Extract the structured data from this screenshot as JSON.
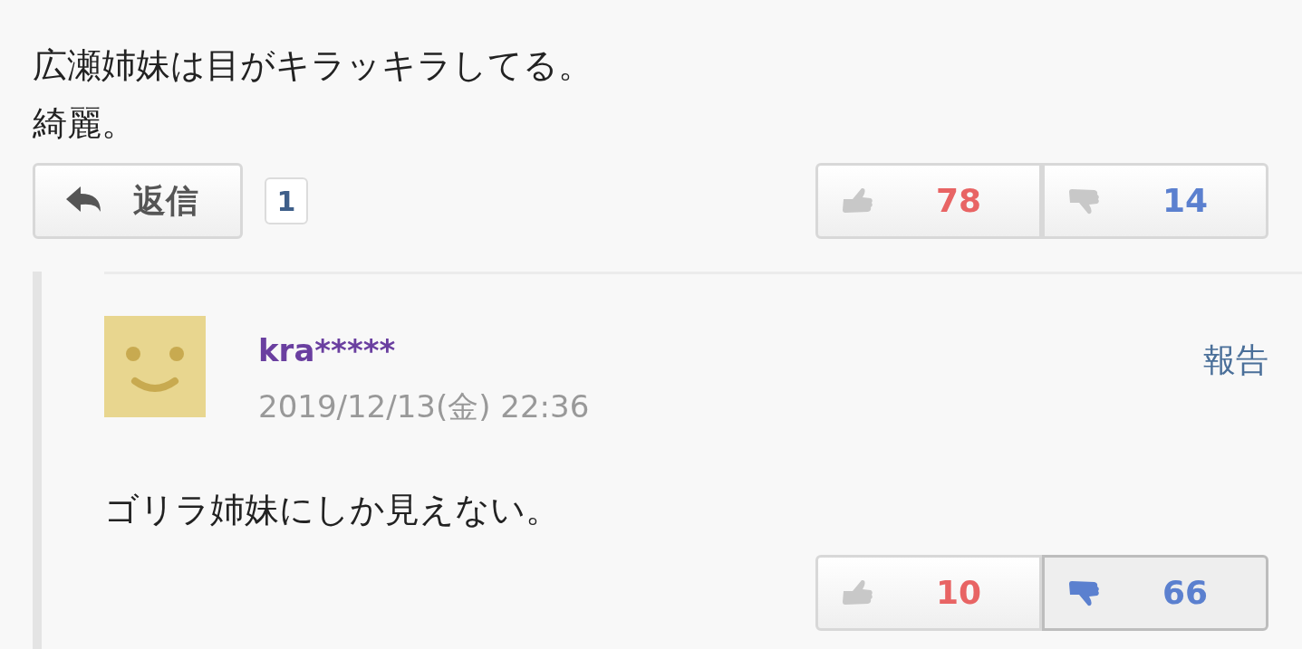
{
  "comment": {
    "text_lines": [
      "広瀬姉妹は目がキラッキラしてる。",
      "綺麗。"
    ],
    "reply_button": "返信",
    "reply_count": "1",
    "votes": [
      {
        "kind": "up",
        "count": "78",
        "selected": false
      },
      {
        "kind": "down",
        "count": "14",
        "selected": false
      }
    ]
  },
  "reply": {
    "user": "kra*****",
    "date": "2019/12/13(金) 22:36",
    "report": "報告",
    "text": "ゴリラ姉妹にしか見えない。",
    "votes": [
      {
        "kind": "up",
        "count": "10",
        "selected": false
      },
      {
        "kind": "down",
        "count": "66",
        "selected": true
      }
    ]
  }
}
